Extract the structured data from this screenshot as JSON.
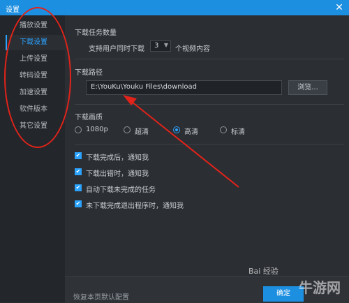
{
  "window": {
    "title": "设置"
  },
  "sidebar": {
    "items": [
      {
        "label": "播放设置"
      },
      {
        "label": "下载设置"
      },
      {
        "label": "上传设置"
      },
      {
        "label": "转码设置"
      },
      {
        "label": "加速设置"
      },
      {
        "label": "软件版本"
      },
      {
        "label": "其它设置"
      }
    ]
  },
  "download_count": {
    "title": "下载任务数量",
    "prefix": "支持用户同时下载",
    "value": "3",
    "suffix": "个视频内容"
  },
  "download_path": {
    "title": "下载路径",
    "value": "E:\\YouKu\\Youku Files\\download",
    "browse_label": "浏览..."
  },
  "quality": {
    "title": "下载画质",
    "options": [
      "1080p",
      "超清",
      "高清",
      "标清"
    ],
    "selected": "高清"
  },
  "notifications": [
    {
      "label": "下载完成后，通知我",
      "checked": true
    },
    {
      "label": "下载出错时，通知我",
      "checked": true
    },
    {
      "label": "自动下载未完成的任务",
      "checked": true
    },
    {
      "label": "未下载完成退出程序时，通知我",
      "checked": true
    }
  ],
  "footer": {
    "restore_label": "恢复本页默认配置",
    "confirm_label": "确定"
  },
  "watermark": {
    "left": "Bai 经验",
    "right": "牛游网"
  },
  "colors": {
    "accent": "#1d8fe0",
    "annotation": "#e2231a"
  }
}
